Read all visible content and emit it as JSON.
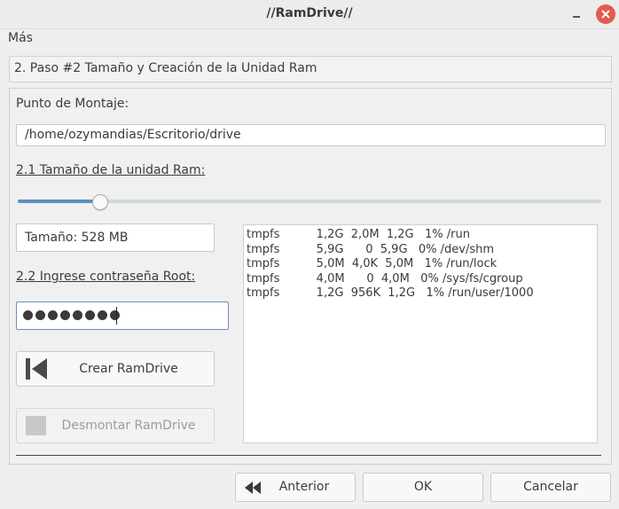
{
  "window": {
    "title": "//RamDrive//"
  },
  "menubar": {
    "items": [
      "Más"
    ]
  },
  "step": {
    "label": "2. Paso #2 Tamaño y Creación de la Unidad Ram"
  },
  "mount": {
    "label": "Punto de Montaje:",
    "value": "/home/ozymandias/Escritorio/drive"
  },
  "size": {
    "label": "2.1 Tamaño de la unidad Ram:",
    "slider_fraction": 0.14,
    "display": "Tamaño: 528 MB"
  },
  "password": {
    "label": "2.2 Ingrese contraseña Root:",
    "masked_length": 8
  },
  "buttons": {
    "create": "Crear RamDrive",
    "unmount": "Desmontar RamDrive"
  },
  "df_output": "tmpfs          1,2G  2,0M  1,2G   1% /run\ntmpfs          5,9G      0  5,9G   0% /dev/shm\ntmpfs          5,0M  4,0K  5,0M   1% /run/lock\ntmpfs          4,0M      0  4,0M   0% /sys/fs/cgroup\ntmpfs          1,2G  956K  1,2G   1% /run/user/1000",
  "footer": {
    "back": "Anterior",
    "ok": "OK",
    "cancel": "Cancelar"
  },
  "colors": {
    "accent": "#5f8fc0",
    "close": "#e35b4f"
  }
}
